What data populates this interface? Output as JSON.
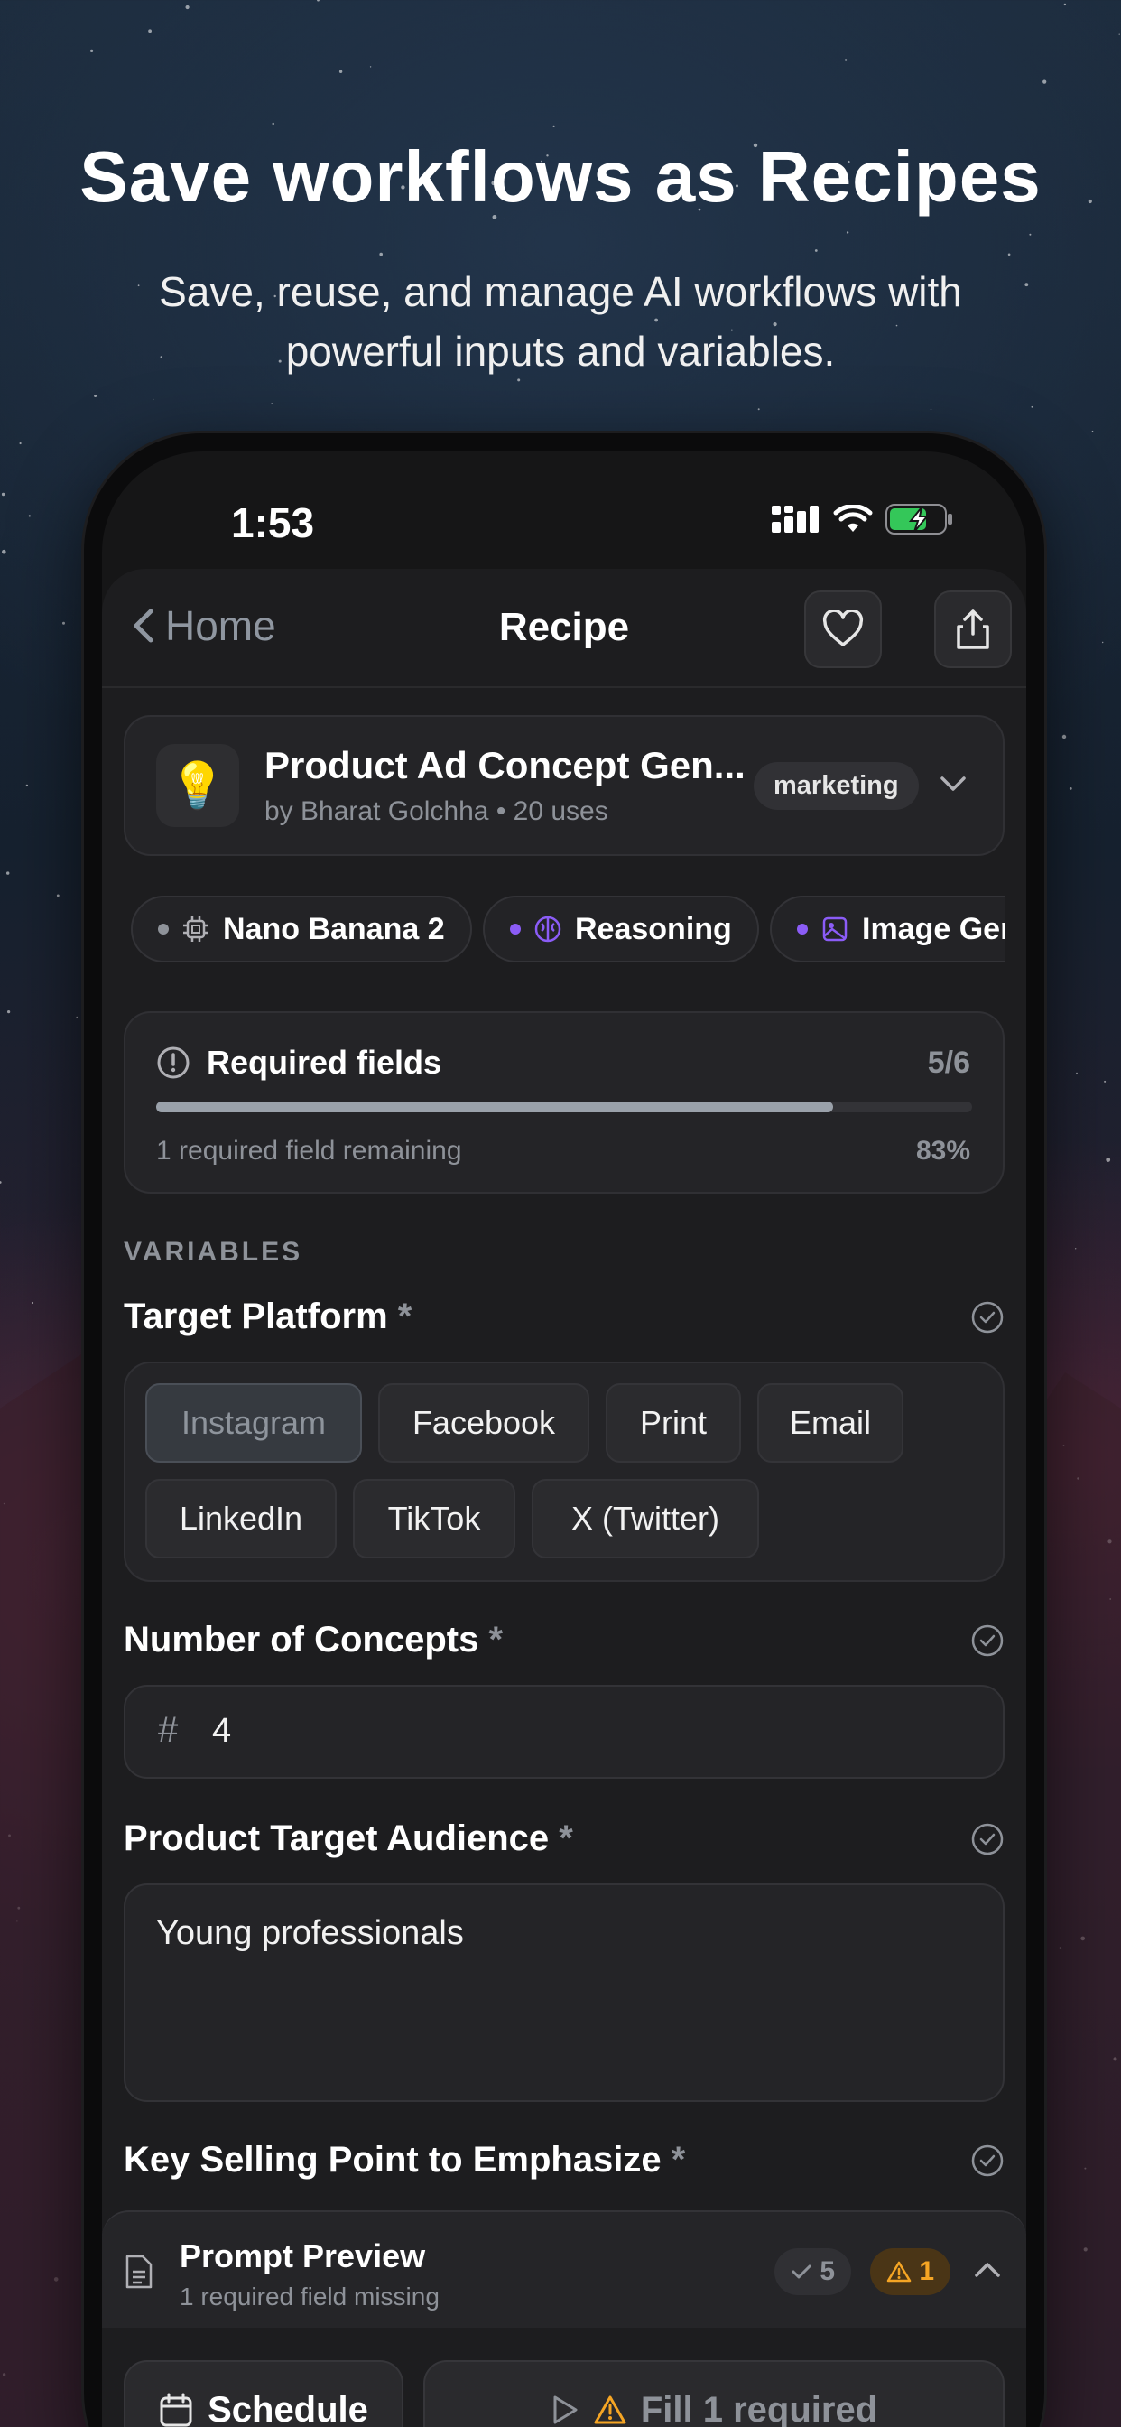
{
  "marketing": {
    "headline": "Save workflows as Recipes",
    "subline": "Save, reuse, and manage AI workflows with powerful inputs and variables."
  },
  "status": {
    "time": "1:53"
  },
  "nav": {
    "back_label": "Home",
    "title": "Recipe"
  },
  "recipe": {
    "icon": "lightbulb-icon",
    "title": "Product Ad Concept Gen...",
    "subtitle": "by Bharat Golchha • 20 uses",
    "tag": "marketing"
  },
  "chips": [
    {
      "label": "Nano Banana 2",
      "icon": "chip-icon",
      "dot_color": "#8e9299"
    },
    {
      "label": "Reasoning",
      "icon": "brain-icon",
      "dot_color": "#8b5cf6"
    },
    {
      "label": "Image Ger",
      "icon": "image-icon",
      "dot_color": "#8b5cf6"
    }
  ],
  "required": {
    "title": "Required fields",
    "count": "5/6",
    "progress": 0.83,
    "remaining": "1 required field remaining",
    "percent": "83%"
  },
  "variables_label": "VARIABLES",
  "fields": {
    "platform": {
      "label": "Target Platform",
      "star": "*",
      "options": [
        "Instagram",
        "Facebook",
        "Print",
        "Email",
        "LinkedIn",
        "TikTok",
        "X (Twitter)"
      ],
      "selected": "Instagram"
    },
    "concepts": {
      "label": "Number of Concepts",
      "star": "*",
      "prefix": "#",
      "value": "4"
    },
    "audience": {
      "label": "Product Target Audience",
      "star": "*",
      "value": "Young professionals"
    },
    "selling": {
      "label": "Key Selling Point to Emphasize",
      "star": "*"
    }
  },
  "preview": {
    "title": "Prompt Preview",
    "subtitle": "1 required field missing",
    "ok_count": "5",
    "warn_count": "1"
  },
  "actions": {
    "schedule": "Schedule",
    "run": "Fill 1 required"
  },
  "colors": {
    "accent_purple": "#8b5cf6",
    "warning": "#f5a524",
    "bg": "#1d1d1f"
  }
}
